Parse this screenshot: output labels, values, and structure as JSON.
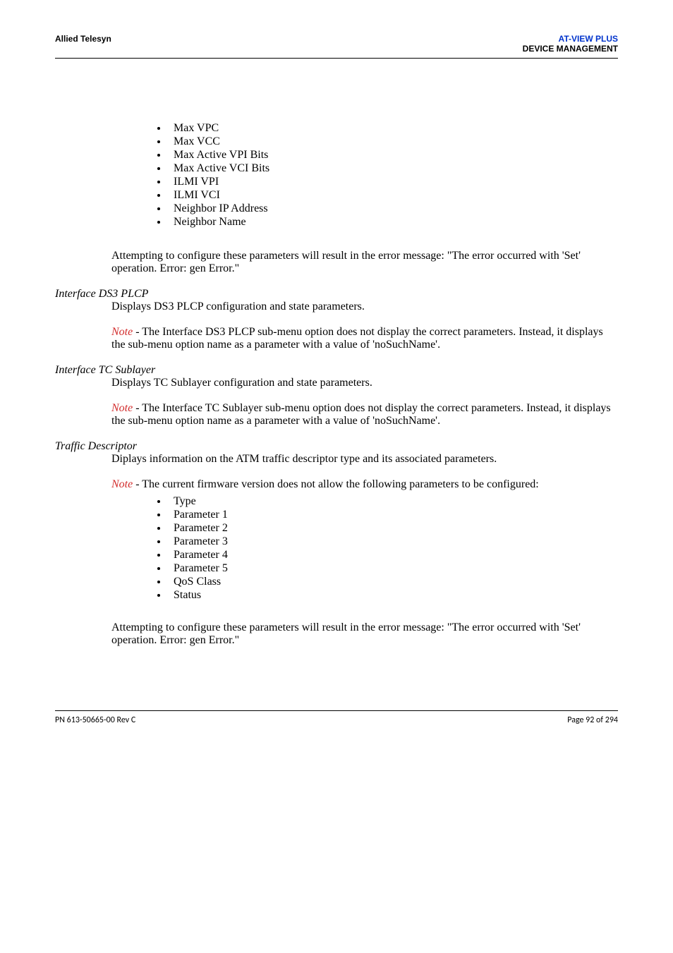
{
  "header": {
    "left": "Allied Telesyn",
    "rightLine1": "AT-VIEW PLUS",
    "rightLine2": "DEVICE MANAGEMENT"
  },
  "list1": {
    "items": [
      "Max VPC",
      "Max VCC",
      "Max Active VPI Bits",
      "Max Active VCI Bits",
      "ILMI VPI",
      "ILMI VCI",
      "Neighbor IP Address",
      "Neighbor Name"
    ]
  },
  "para1": "Attempting to configure these parameters will result in the error message: \"The error occurred with 'Set' operation. Error: gen Error.\"",
  "section1": {
    "heading": "Interface DS3 PLCP",
    "desc": "Displays DS3 PLCP configuration and state parameters.",
    "noteLabel": "Note",
    "noteBody": " - The Interface DS3 PLCP sub-menu option does not display the correct parameters. Instead, it displays the sub-menu option name as a parameter with a value of 'noSuchName'."
  },
  "section2": {
    "heading": "Interface TC Sublayer",
    "desc": "Displays TC Sublayer configuration and state parameters.",
    "noteLabel": "Note",
    "noteBody": " - The Interface TC Sublayer sub-menu option does not display the correct parameters. Instead, it displays the sub-menu option name as a parameter with a value of 'noSuchName'."
  },
  "section3": {
    "heading": "Traffic Descriptor",
    "desc": "Diplays information on the ATM traffic descriptor type and its associated parameters.",
    "noteLabel": "Note",
    "noteBody": " - The current firmware version does not allow the following parameters to be configured:"
  },
  "list2": {
    "items": [
      "Type",
      "Parameter 1",
      "Parameter 2",
      "Parameter 3",
      "Parameter 4",
      "Parameter 5",
      "QoS Class",
      "Status"
    ]
  },
  "para2": "Attempting to configure these parameters will result in the error message: \"The error occurred with 'Set' operation. Error: gen Error.\"",
  "footer": {
    "left": "PN 613-50665-00 Rev C",
    "right": "Page 92 of 294"
  }
}
